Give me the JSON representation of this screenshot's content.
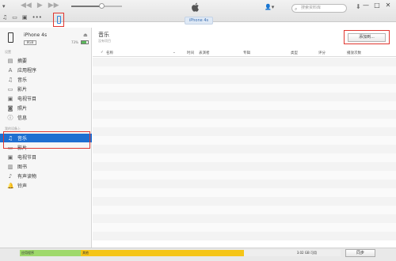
{
  "toolbar": {
    "menu": "▾",
    "transport": [
      "◀◀",
      "▶",
      "▶▶"
    ],
    "volume_level": 0.6,
    "account": "👤▾",
    "search_placeholder": "搜索资料库",
    "center_tab": "iPhone 4s",
    "window_controls": [
      "—",
      "□",
      "✕"
    ]
  },
  "device": {
    "name": "iPhone 4s",
    "capacity": "8GB",
    "battery_pct": "73%",
    "battery_level": 0.73
  },
  "sidebar": {
    "settings_header": "设置",
    "settings": [
      {
        "label": "摘要",
        "icon": "summary-icon"
      },
      {
        "label": "应用程序",
        "icon": "apps-icon"
      },
      {
        "label": "音乐",
        "icon": "music-icon"
      },
      {
        "label": "影片",
        "icon": "movies-icon"
      },
      {
        "label": "电视节目",
        "icon": "tv-icon"
      },
      {
        "label": "照片",
        "icon": "photos-icon"
      },
      {
        "label": "信息",
        "icon": "info-icon"
      }
    ],
    "ondevice_header": "我的设备上",
    "ondevice": [
      {
        "label": "音乐",
        "icon": "music-icon",
        "selected": true
      },
      {
        "label": "影片",
        "icon": "movies-icon"
      },
      {
        "label": "电视节目",
        "icon": "tv-icon"
      },
      {
        "label": "图书",
        "icon": "books-icon"
      },
      {
        "label": "有声读物",
        "icon": "audiobooks-icon"
      },
      {
        "label": "铃声",
        "icon": "ringtones-icon"
      }
    ]
  },
  "main": {
    "title": "音乐",
    "subtitle": "没有项目",
    "add_button": "添加到...",
    "columns": [
      "✓",
      "名称",
      "时间",
      "表演者",
      "专辑",
      "类型",
      "评分",
      "播放次数"
    ]
  },
  "storage": {
    "segments": [
      {
        "label": "应用程序",
        "color": "#9fd96b",
        "fraction": 0.19
      },
      {
        "label": "其他",
        "color": "#f5c518",
        "fraction": 0.51
      },
      {
        "label": "3.02 GB 可用",
        "color": "#eeeeee",
        "fraction": 0.3
      }
    ],
    "sync_button": "同步"
  },
  "colors": {
    "accent": "#1f6fd1",
    "highlight": "#e0362f"
  }
}
